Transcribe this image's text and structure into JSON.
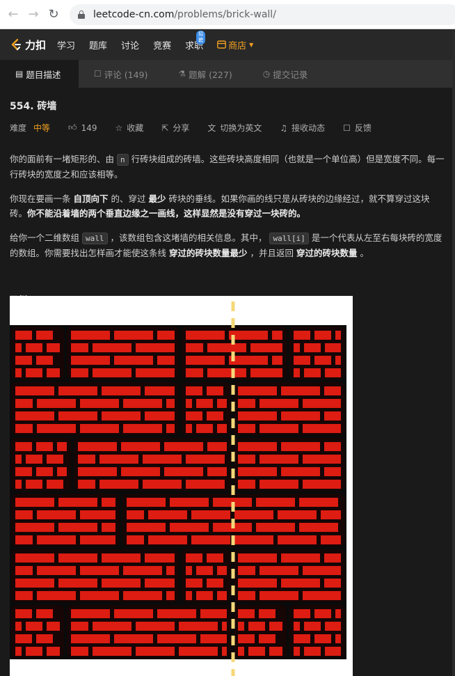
{
  "browser": {
    "url_host": "leetcode-cn.com",
    "url_path": "/problems/brick-wall/"
  },
  "site_nav": {
    "logo_text": "力扣",
    "items": [
      "学习",
      "题库",
      "讨论",
      "竞赛",
      "求职"
    ],
    "badge": "招聘",
    "store": "商店"
  },
  "tabs": [
    {
      "label": "题目描述"
    },
    {
      "label": "评论 (149)"
    },
    {
      "label": "题解 (227)"
    },
    {
      "label": "提交记录"
    }
  ],
  "problem": {
    "title": "554. 砖墙",
    "difficulty_label": "难度",
    "difficulty": "中等",
    "likes": "149",
    "favorite": "收藏",
    "share": "分享",
    "switch_lang": "切换为英文",
    "subscribe": "接收动态",
    "feedback": "反馈"
  },
  "description": {
    "p1_a": "你的面前有一堵矩形的、由",
    "p1_code": "n",
    "p1_b": "行砖块组成的砖墙。这些砖块高度相同（也就是一个单位高）但是宽度不同。每一行砖块的宽度之和应该相等。",
    "p2_a": "你现在要画一条",
    "p2_b1": "自顶向下",
    "p2_c": "的、穿过",
    "p2_b2": "最少",
    "p2_d": "砖块的垂线。如果你画的线只是从砖块的边缘经过，就不算穿过这块砖。",
    "p2_b3": "你不能沿着墙的两个垂直边缘之一画线，这样显然是没有穿过一块砖的。",
    "p3_a": "给你一个二维数组",
    "p3_code1": "wall",
    "p3_b": "，该数组包含这堵墙的相关信息。其中，",
    "p3_code2": "wall[i]",
    "p3_c": "是一个代表从左至右每块砖的宽度的数组。你需要找出怎样画才能使这条线",
    "p3_b1": "穿过的砖块数量最少",
    "p3_d": "，并且返回",
    "p3_b2": "穿过的砖块数量",
    "p3_e": "。",
    "example_label": "示例 1："
  },
  "colors": {
    "brick": "#dd1c12",
    "mortar": "#0a0a0a",
    "line": "#f6d878",
    "store": "#f0a020"
  }
}
